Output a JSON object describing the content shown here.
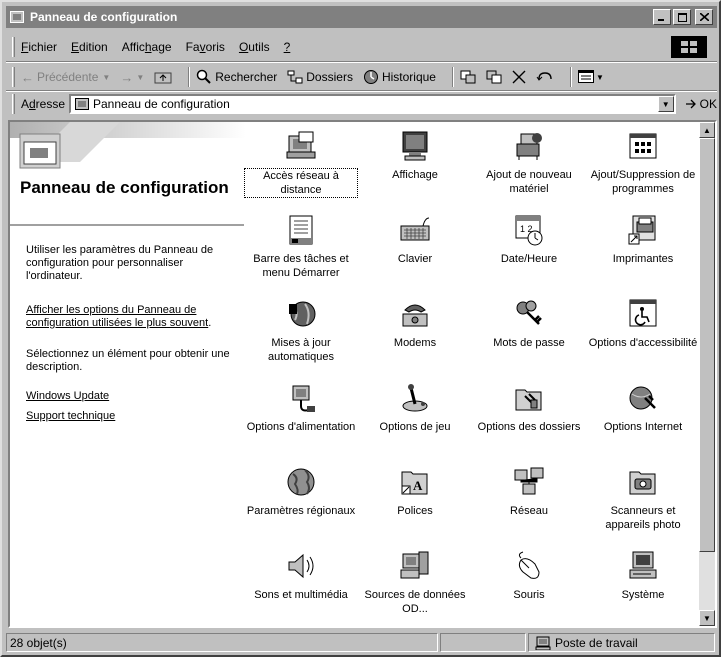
{
  "window": {
    "title": "Panneau de configuration"
  },
  "menubar": {
    "items": [
      {
        "pre": "",
        "key": "F",
        "post": "ichier"
      },
      {
        "pre": "",
        "key": "E",
        "post": "dition"
      },
      {
        "pre": "Affic",
        "key": "h",
        "post": "age"
      },
      {
        "pre": "Fa",
        "key": "v",
        "post": "oris"
      },
      {
        "pre": "",
        "key": "O",
        "post": "utils"
      },
      {
        "pre": "",
        "key": "?",
        "post": ""
      }
    ]
  },
  "toolbar": {
    "back": "Précédente",
    "search": "Rechercher",
    "folders": "Dossiers",
    "history": "Historique"
  },
  "address": {
    "label_pre": "A",
    "label_key": "d",
    "label_post": "resse",
    "value": "Panneau de configuration",
    "go": "OK"
  },
  "leftpane": {
    "title": "Panneau de configuration",
    "intro": "Utiliser les paramètres du Panneau de configuration pour personnaliser l'ordinateur.",
    "classic_link": "Afficher les options du Panneau de configuration utilisées le plus souvent",
    "classic_tail": ".",
    "select_hint": "Sélectionnez un élément pour obtenir une description.",
    "links": [
      "Windows Update",
      "Support technique"
    ]
  },
  "items": [
    {
      "label": "Accès réseau à distance",
      "icon": "dialup-icon"
    },
    {
      "label": "Affichage",
      "icon": "display-icon"
    },
    {
      "label": "Ajout de nouveau matériel",
      "icon": "add-hardware-icon"
    },
    {
      "label": "Ajout/Suppression de programmes",
      "icon": "add-remove-programs-icon"
    },
    {
      "label": "Barre des tâches et menu Démarrer",
      "icon": "taskbar-icon"
    },
    {
      "label": "Clavier",
      "icon": "keyboard-icon"
    },
    {
      "label": "Date/Heure",
      "icon": "date-time-icon"
    },
    {
      "label": "Imprimantes",
      "icon": "printers-icon"
    },
    {
      "label": "Mises à jour automatiques",
      "icon": "auto-update-icon"
    },
    {
      "label": "Modems",
      "icon": "modem-icon"
    },
    {
      "label": "Mots de passe",
      "icon": "passwords-icon"
    },
    {
      "label": "Options d'accessibilité",
      "icon": "accessibility-icon"
    },
    {
      "label": "Options d'alimentation",
      "icon": "power-icon"
    },
    {
      "label": "Options de jeu",
      "icon": "game-controller-icon"
    },
    {
      "label": "Options des dossiers",
      "icon": "folder-options-icon"
    },
    {
      "label": "Options Internet",
      "icon": "internet-options-icon"
    },
    {
      "label": "Paramètres régionaux",
      "icon": "regional-globe-icon"
    },
    {
      "label": "Polices",
      "icon": "fonts-icon"
    },
    {
      "label": "Réseau",
      "icon": "network-icon"
    },
    {
      "label": "Scanneurs et appareils photo",
      "icon": "scanner-camera-icon"
    },
    {
      "label": "Sons et multimédia",
      "icon": "sound-icon"
    },
    {
      "label": "Sources de données OD...",
      "icon": "odbc-icon"
    },
    {
      "label": "Souris",
      "icon": "mouse-icon"
    },
    {
      "label": "Système",
      "icon": "system-icon"
    }
  ],
  "status": {
    "count": "28 objet(s)",
    "zone": "Poste de travail"
  }
}
